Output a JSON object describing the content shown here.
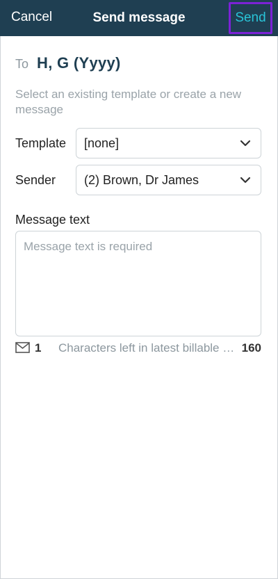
{
  "header": {
    "cancel_label": "Cancel",
    "title": "Send message",
    "send_label": "Send"
  },
  "recipient": {
    "to_label": "To",
    "name": "H, G (Yyyy)"
  },
  "hint": "Select an existing template or create a new message",
  "template": {
    "label": "Template",
    "value": "[none]"
  },
  "sender": {
    "label": "Sender",
    "value": "(2) Brown, Dr James"
  },
  "message": {
    "label": "Message text",
    "placeholder": "Message text is required",
    "value": ""
  },
  "footer": {
    "message_count": "1",
    "chars_left_label": "Characters left in latest billable message",
    "chars_left_value": "160"
  },
  "colors": {
    "header_bg": "#1f3f52",
    "send_accent": "#29c4d8",
    "highlight_border": "#7b22d6"
  },
  "icons": {
    "select_chevron": "chevron-down-icon",
    "message_count": "envelope-icon"
  }
}
